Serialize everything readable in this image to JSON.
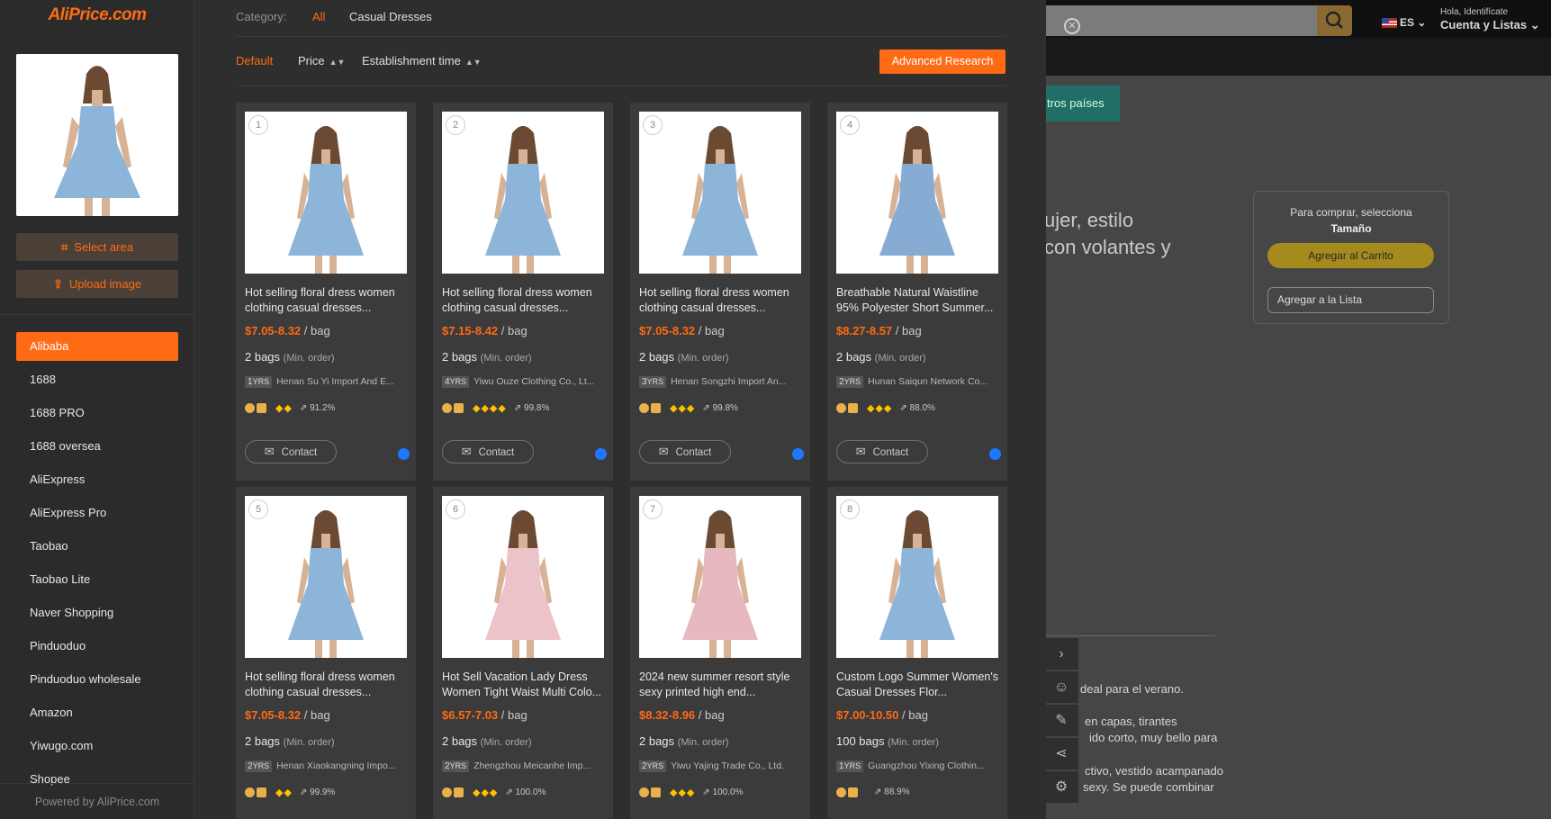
{
  "brand": {
    "logo": "AliPrice.com",
    "powered_by": "Powered by AliPrice.com",
    "accent": "#ff6a14"
  },
  "sidebar": {
    "select_area": "Select area",
    "upload_image": "Upload image",
    "platforms": [
      "Alibaba",
      "1688",
      "1688 PRO",
      "1688 oversea",
      "AliExpress",
      "AliExpress Pro",
      "Taobao",
      "Taobao Lite",
      "Naver Shopping",
      "Pinduoduo",
      "Pinduoduo wholesale",
      "Amazon",
      "Yiwugo.com",
      "Shopee"
    ],
    "active_platform": "Alibaba"
  },
  "category": {
    "label": "Category:",
    "all": "All",
    "current": "Casual Dresses"
  },
  "sort": {
    "default": "Default",
    "price": "Price",
    "establishment": "Establishment time",
    "advanced": "Advanced Research"
  },
  "contact_label": "Contact",
  "min_order_label": "(Min. order)",
  "yrs_label": "YRS",
  "products": [
    {
      "num": "1",
      "title": "Hot selling floral dress women clothing casual dresses...",
      "price": "$7.05-8.32",
      "unit": "/ bag",
      "moq": "2 bags",
      "years": "1",
      "supplier": "Henan Su Yi Import And E...",
      "diamonds": "◆◆",
      "rate": "91.2%",
      "dress_color": "#8db4d9"
    },
    {
      "num": "2",
      "title": "Hot selling floral dress women clothing casual dresses...",
      "price": "$7.15-8.42",
      "unit": "/ bag",
      "moq": "2 bags",
      "years": "4",
      "supplier": "Yiwu Ouze Clothing Co., Lt...",
      "diamonds": "◆◆◆◆",
      "rate": "99.8%",
      "dress_color": "#8db4d9"
    },
    {
      "num": "3",
      "title": "Hot selling floral dress women clothing casual dresses...",
      "price": "$7.05-8.32",
      "unit": "/ bag",
      "moq": "2 bags",
      "years": "3",
      "supplier": "Henan Songzhi Import An...",
      "diamonds": "◆◆◆",
      "rate": "99.8%",
      "dress_color": "#8db4d9"
    },
    {
      "num": "4",
      "title": "Breathable Natural Waistline 95% Polyester Short Summer...",
      "price": "$8.27-8.57",
      "unit": "/ bag",
      "moq": "2 bags",
      "years": "2",
      "supplier": "Hunan Saiqun Network Co...",
      "diamonds": "◆◆◆",
      "rate": "88.0%",
      "dress_color": "#86acd4"
    },
    {
      "num": "5",
      "title": "Hot selling floral dress women clothing casual dresses...",
      "price": "$7.05-8.32",
      "unit": "/ bag",
      "moq": "2 bags",
      "years": "2",
      "supplier": "Henan Xiaokangning Impo...",
      "diamonds": "◆◆",
      "rate": "99.9%",
      "dress_color": "#8db4d9"
    },
    {
      "num": "6",
      "title": "Hot Sell Vacation Lady Dress Women Tight Waist Multi Colo...",
      "price": "$6.57-7.03",
      "unit": "/ bag",
      "moq": "2 bags",
      "years": "2",
      "supplier": "Zhengzhou Meicanhe Imp...",
      "diamonds": "◆◆◆",
      "rate": "100.0%",
      "dress_color": "#ecc3c8"
    },
    {
      "num": "7",
      "title": "2024 new summer resort style sexy printed high end...",
      "price": "$8.32-8.96",
      "unit": "/ bag",
      "moq": "2 bags",
      "years": "2",
      "supplier": "Yiwu Yajing Trade Co., Ltd.",
      "diamonds": "◆◆◆",
      "rate": "100.0%",
      "dress_color": "#e7b9bf"
    },
    {
      "num": "8",
      "title": "Custom Logo Summer Women's Casual Dresses Flor...",
      "price": "$7.00-10.50",
      "unit": "/ bag",
      "moq": "100 bags",
      "years": "1",
      "supplier": "Guangzhou Yixing Clothin...",
      "diamonds": "",
      "rate": "88.9%",
      "dress_color": "#8db4d9"
    }
  ],
  "background_page": {
    "lang": "ES",
    "hola": "Hola, Identifícate",
    "cuenta": "Cuenta y Listas",
    "green_button": "tros países",
    "title_line1": "ujer, estilo",
    "title_line2": "con volantes y",
    "buy_prompt": "Para comprar, selecciona",
    "buy_size": "Tamaño",
    "add_to_cart": "Agregar al Carrito",
    "add_to_list": "Agregar a la Lista",
    "desc1": "deal para el verano.",
    "desc2": "en capas, tirantes",
    "desc3": "ido corto, muy bello para",
    "desc4": "ctivo, vestido acampanado",
    "desc5": "sexy. Se puede combinar"
  }
}
